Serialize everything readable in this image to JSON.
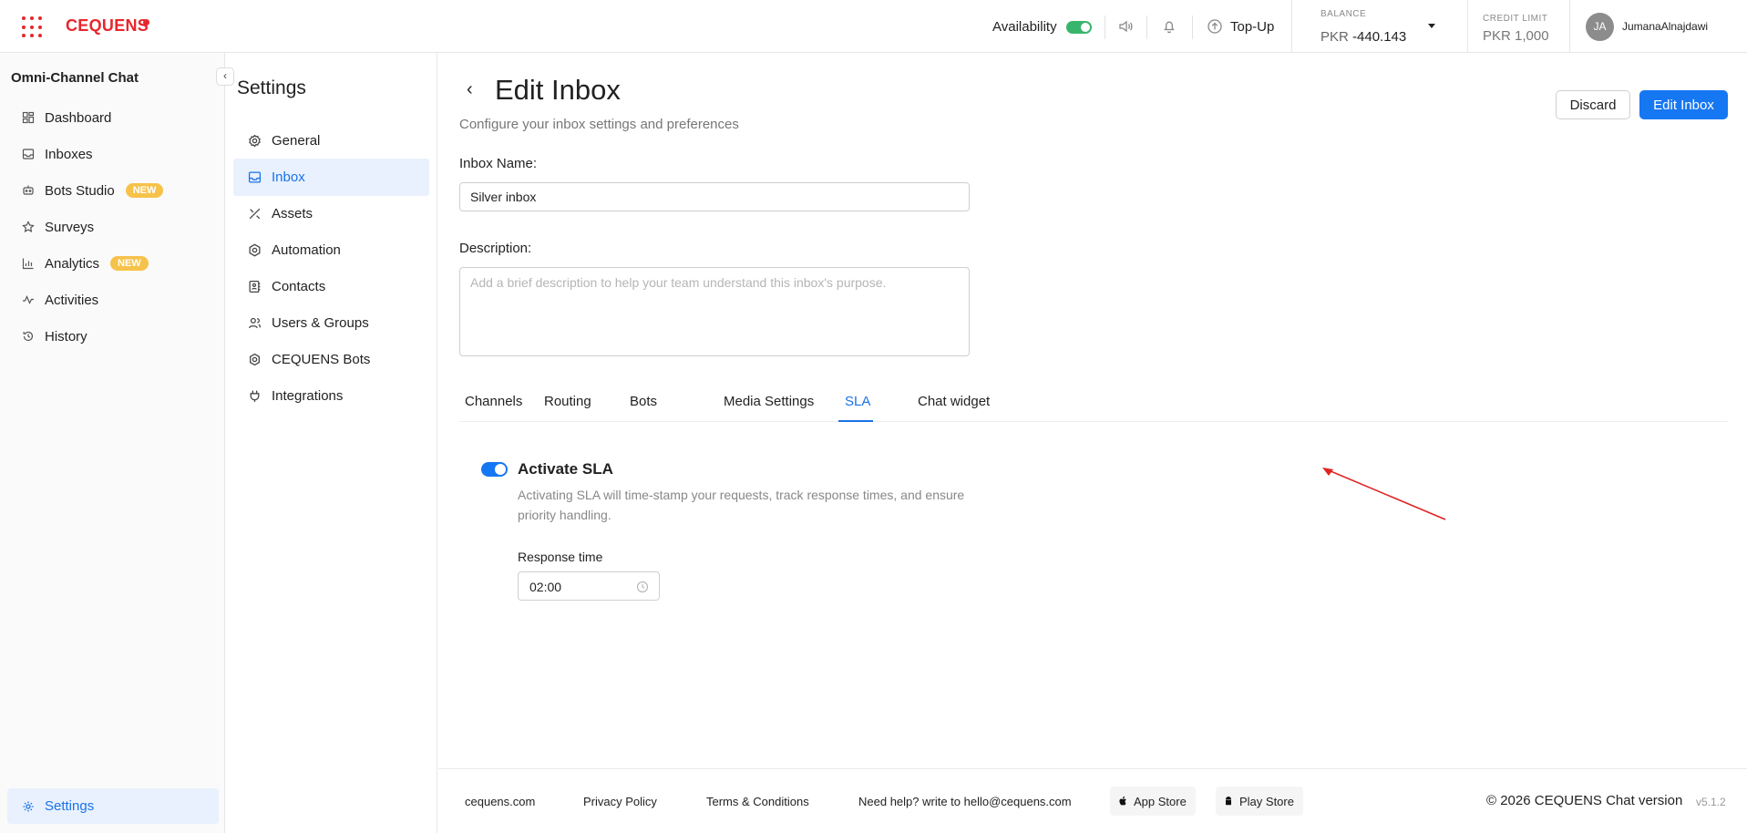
{
  "brand": {
    "name": "CEQUENS",
    "color": "#e8262d"
  },
  "topbar": {
    "availability_label": "Availability",
    "availability_on": true,
    "topup_label": "Top-Up",
    "balance_label": "BALANCE",
    "balance_currency": "PKR",
    "balance_value": "-440.143",
    "credit_label": "CREDIT LIMIT",
    "credit_value": "PKR 1,000",
    "avatar_initials": "JA",
    "username": "JumanaAlnajdawi"
  },
  "sidebar": {
    "title": "Omni-Channel Chat",
    "items": [
      {
        "label": "Dashboard",
        "icon": "dashboard-icon"
      },
      {
        "label": "Inboxes",
        "icon": "inbox-icon"
      },
      {
        "label": "Bots Studio",
        "icon": "bot-icon",
        "badge": "NEW"
      },
      {
        "label": "Surveys",
        "icon": "star-icon"
      },
      {
        "label": "Analytics",
        "icon": "bar-chart-icon",
        "badge": "NEW"
      },
      {
        "label": "Activities",
        "icon": "activity-icon"
      },
      {
        "label": "History",
        "icon": "history-icon"
      }
    ],
    "settings_label": "Settings"
  },
  "settings_menu": {
    "title": "Settings",
    "items": [
      {
        "label": "General",
        "icon": "gear-icon"
      },
      {
        "label": "Inbox",
        "icon": "inbox-icon",
        "active": true
      },
      {
        "label": "Assets",
        "icon": "tools-icon"
      },
      {
        "label": "Automation",
        "icon": "automation-icon"
      },
      {
        "label": "Contacts",
        "icon": "contacts-icon"
      },
      {
        "label": "Users & Groups",
        "icon": "users-icon"
      },
      {
        "label": "CEQUENS Bots",
        "icon": "bot-icon"
      },
      {
        "label": "Integrations",
        "icon": "plug-icon"
      }
    ]
  },
  "page": {
    "title": "Edit Inbox",
    "subtitle": "Configure your inbox settings and preferences",
    "discard_label": "Discard",
    "edit_label": "Edit Inbox",
    "inbox_name_label": "Inbox Name:",
    "inbox_name_value": "Silver inbox",
    "description_label": "Description:",
    "description_placeholder": "Add a brief description to help your team understand this inbox's purpose.",
    "tabs": [
      "Channels",
      "Routing",
      "Bots",
      "Media Settings",
      "SLA",
      "Chat widget"
    ],
    "active_tab": "SLA",
    "sla": {
      "enabled": true,
      "title": "Activate SLA",
      "description": "Activating SLA will time-stamp your requests, track response times, and ensure priority handling.",
      "response_time_label": "Response time",
      "response_time_value": "02:00"
    },
    "accent_color": "#1677f2",
    "annotation_color": "#e02424"
  },
  "footer": {
    "links": [
      "cequens.com",
      "Privacy Policy",
      "Terms & Conditions",
      "Need help? write to hello@cequens.com"
    ],
    "app_store": "App Store",
    "play_store": "Play Store",
    "copyright": "© 2026 CEQUENS Chat version",
    "version": "v5.1.2"
  }
}
